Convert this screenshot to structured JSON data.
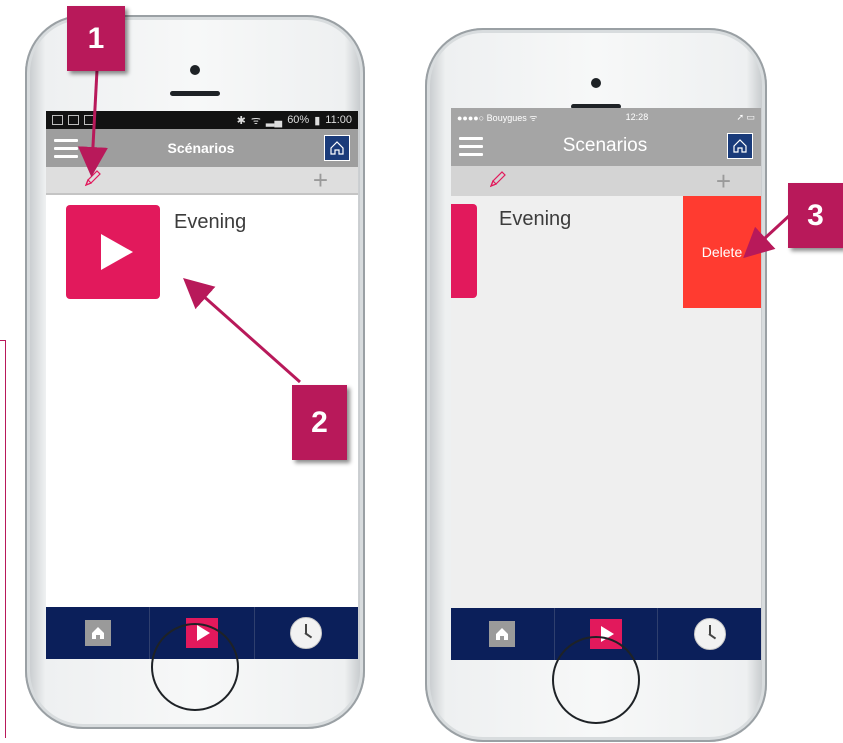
{
  "badges": {
    "step1": "1",
    "step2": "2",
    "step3": "3"
  },
  "left_phone": {
    "statusbar": {
      "right": "11:00",
      "battery": "60%"
    },
    "title": "Scénarios",
    "scenario": "Evening"
  },
  "right_phone": {
    "statusbar": {
      "carrier": "●●●●○ Bouygues ᯤ",
      "time": "12:28",
      "right": "➚ ▭"
    },
    "title": "Scenarios",
    "scenario": "Evening",
    "delete_label": "Delete"
  },
  "colors": {
    "accent": "#e2195c",
    "badge": "#b8195a",
    "tabbar": "#0b1f5a",
    "delete": "#ff3b30",
    "navbar": "#9e9e9e"
  },
  "icons": [
    "menu-icon",
    "home-icon",
    "pencil-icon",
    "plus-icon",
    "play-icon",
    "clock-icon"
  ]
}
